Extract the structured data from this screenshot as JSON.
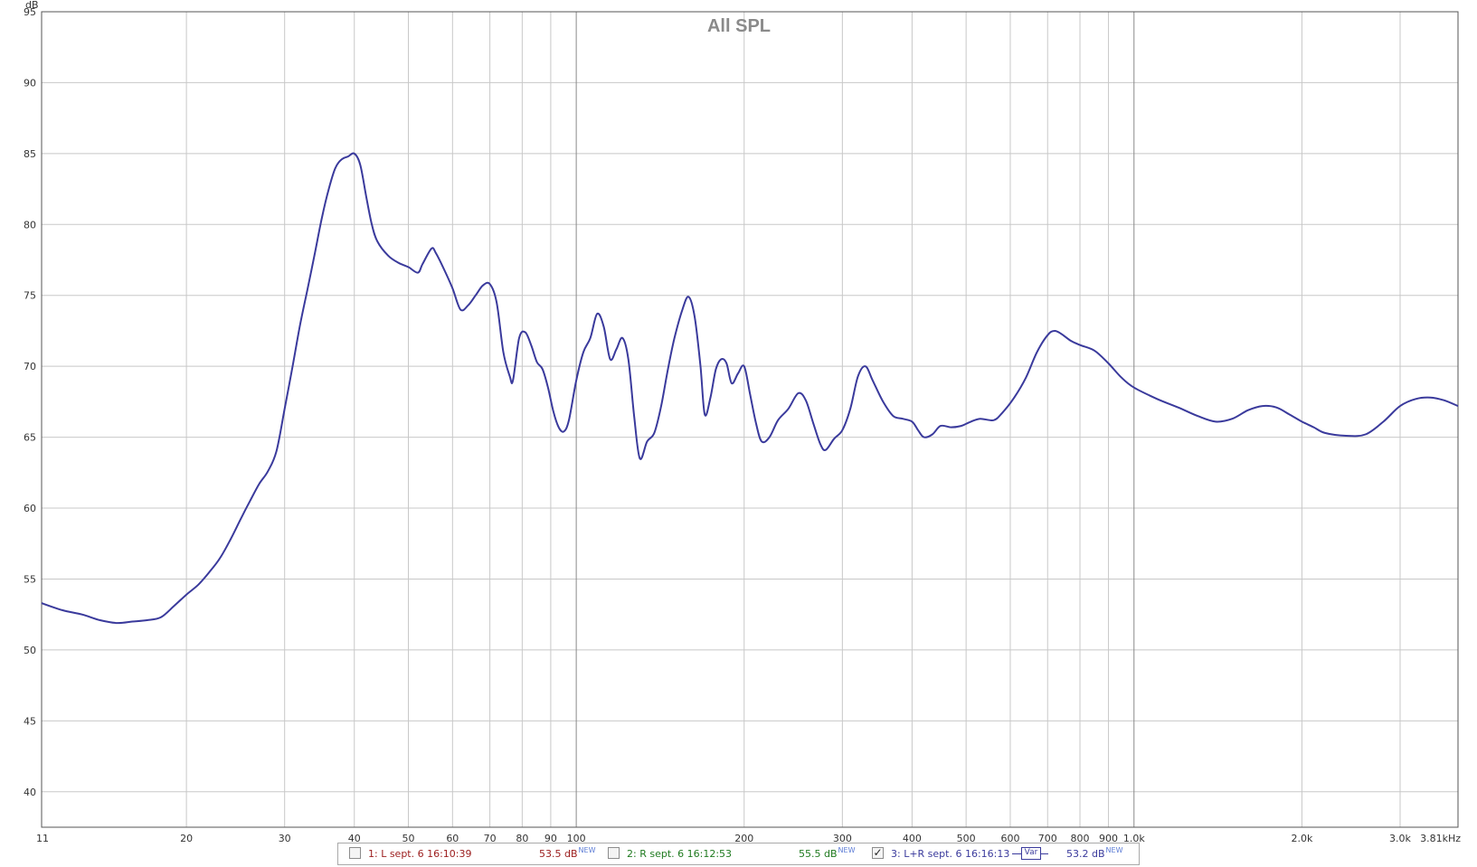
{
  "chart_data": {
    "type": "line",
    "title": "All SPL",
    "ylabel": "dB",
    "xscale": "log",
    "xlim": [
      11,
      3810
    ],
    "ylim": [
      37.5,
      95
    ],
    "grid": true,
    "legend_position": "bottom-center",
    "x_ticks": [
      {
        "value": 11,
        "label": "11"
      },
      {
        "value": 20,
        "label": "20"
      },
      {
        "value": 30,
        "label": "30"
      },
      {
        "value": 40,
        "label": "40"
      },
      {
        "value": 50,
        "label": "50"
      },
      {
        "value": 60,
        "label": "60"
      },
      {
        "value": 70,
        "label": "70"
      },
      {
        "value": 80,
        "label": "80"
      },
      {
        "value": 90,
        "label": "90"
      },
      {
        "value": 100,
        "label": "100"
      },
      {
        "value": 200,
        "label": "200"
      },
      {
        "value": 300,
        "label": "300"
      },
      {
        "value": 400,
        "label": "400"
      },
      {
        "value": 500,
        "label": "500"
      },
      {
        "value": 600,
        "label": "600"
      },
      {
        "value": 700,
        "label": "700"
      },
      {
        "value": 800,
        "label": "800"
      },
      {
        "value": 900,
        "label": "900"
      },
      {
        "value": 1000,
        "label": "1.0k"
      },
      {
        "value": 2000,
        "label": "2.0k"
      },
      {
        "value": 3000,
        "label": "3.0k"
      },
      {
        "value": 3810,
        "label": "3.81kHz"
      }
    ],
    "y_ticks": [
      95,
      90,
      85,
      80,
      75,
      70,
      65,
      60,
      55,
      50,
      45,
      40
    ],
    "series": [
      {
        "name": "3: L+R sept. 6 16:16:13",
        "color": "#3a3a9c",
        "points": [
          [
            11,
            53.3
          ],
          [
            12,
            52.8
          ],
          [
            13,
            52.5
          ],
          [
            14,
            52.1
          ],
          [
            15,
            51.9
          ],
          [
            16,
            52.0
          ],
          [
            17,
            52.1
          ],
          [
            18,
            52.3
          ],
          [
            19,
            53.1
          ],
          [
            20,
            53.9
          ],
          [
            21,
            54.6
          ],
          [
            22,
            55.5
          ],
          [
            23,
            56.5
          ],
          [
            24,
            57.8
          ],
          [
            25,
            59.2
          ],
          [
            26,
            60.5
          ],
          [
            27,
            61.7
          ],
          [
            28,
            62.6
          ],
          [
            29,
            64.0
          ],
          [
            30,
            67.0
          ],
          [
            31,
            70.0
          ],
          [
            32,
            73.0
          ],
          [
            33,
            75.5
          ],
          [
            34,
            78.0
          ],
          [
            35,
            80.5
          ],
          [
            36,
            82.5
          ],
          [
            37,
            84.0
          ],
          [
            38,
            84.6
          ],
          [
            39,
            84.8
          ],
          [
            40,
            85.0
          ],
          [
            41,
            84.2
          ],
          [
            42,
            82.0
          ],
          [
            43,
            80.0
          ],
          [
            44,
            78.8
          ],
          [
            46,
            77.8
          ],
          [
            48,
            77.3
          ],
          [
            50,
            77.0
          ],
          [
            52,
            76.6
          ],
          [
            53,
            77.2
          ],
          [
            55,
            78.3
          ],
          [
            56,
            78.0
          ],
          [
            58,
            76.8
          ],
          [
            60,
            75.5
          ],
          [
            62,
            74.0
          ],
          [
            64,
            74.3
          ],
          [
            66,
            75.0
          ],
          [
            68,
            75.7
          ],
          [
            70,
            75.8
          ],
          [
            72,
            74.5
          ],
          [
            74,
            71.0
          ],
          [
            76,
            69.3
          ],
          [
            77,
            69.0
          ],
          [
            79,
            72.0
          ],
          [
            81,
            72.4
          ],
          [
            83,
            71.5
          ],
          [
            85,
            70.3
          ],
          [
            87,
            69.8
          ],
          [
            89,
            68.5
          ],
          [
            91,
            66.8
          ],
          [
            93,
            65.7
          ],
          [
            95,
            65.4
          ],
          [
            97,
            66.2
          ],
          [
            100,
            69.0
          ],
          [
            103,
            71.0
          ],
          [
            106,
            72.0
          ],
          [
            109,
            73.7
          ],
          [
            112,
            72.8
          ],
          [
            115,
            70.5
          ],
          [
            118,
            71.2
          ],
          [
            121,
            72.0
          ],
          [
            124,
            70.5
          ],
          [
            127,
            66.5
          ],
          [
            130,
            63.5
          ],
          [
            134,
            64.7
          ],
          [
            138,
            65.3
          ],
          [
            142,
            67.2
          ],
          [
            146,
            69.8
          ],
          [
            150,
            72.0
          ],
          [
            155,
            74.0
          ],
          [
            159,
            74.9
          ],
          [
            163,
            73.5
          ],
          [
            167,
            70.0
          ],
          [
            170,
            66.6
          ],
          [
            174,
            67.8
          ],
          [
            178,
            69.8
          ],
          [
            182,
            70.5
          ],
          [
            186,
            70.2
          ],
          [
            190,
            68.8
          ],
          [
            195,
            69.5
          ],
          [
            200,
            70.0
          ],
          [
            205,
            68.0
          ],
          [
            210,
            66.0
          ],
          [
            215,
            64.7
          ],
          [
            222,
            65.0
          ],
          [
            230,
            66.2
          ],
          [
            240,
            67.0
          ],
          [
            250,
            68.1
          ],
          [
            258,
            67.6
          ],
          [
            266,
            66.0
          ],
          [
            274,
            64.5
          ],
          [
            280,
            64.1
          ],
          [
            290,
            64.9
          ],
          [
            300,
            65.5
          ],
          [
            310,
            67.0
          ],
          [
            320,
            69.3
          ],
          [
            330,
            70.0
          ],
          [
            340,
            69.0
          ],
          [
            355,
            67.5
          ],
          [
            370,
            66.5
          ],
          [
            385,
            66.3
          ],
          [
            400,
            66.1
          ],
          [
            410,
            65.5
          ],
          [
            420,
            65.0
          ],
          [
            435,
            65.2
          ],
          [
            450,
            65.8
          ],
          [
            470,
            65.7
          ],
          [
            490,
            65.8
          ],
          [
            510,
            66.1
          ],
          [
            530,
            66.3
          ],
          [
            560,
            66.2
          ],
          [
            580,
            66.7
          ],
          [
            610,
            67.8
          ],
          [
            640,
            69.2
          ],
          [
            670,
            71.0
          ],
          [
            700,
            72.2
          ],
          [
            720,
            72.5
          ],
          [
            740,
            72.3
          ],
          [
            770,
            71.8
          ],
          [
            800,
            71.5
          ],
          [
            850,
            71.1
          ],
          [
            900,
            70.2
          ],
          [
            950,
            69.2
          ],
          [
            1000,
            68.5
          ],
          [
            1100,
            67.7
          ],
          [
            1200,
            67.1
          ],
          [
            1300,
            66.5
          ],
          [
            1400,
            66.1
          ],
          [
            1500,
            66.3
          ],
          [
            1600,
            66.9
          ],
          [
            1700,
            67.2
          ],
          [
            1800,
            67.1
          ],
          [
            1900,
            66.6
          ],
          [
            2000,
            66.1
          ],
          [
            2100,
            65.7
          ],
          [
            2200,
            65.3
          ],
          [
            2400,
            65.1
          ],
          [
            2600,
            65.2
          ],
          [
            2800,
            66.1
          ],
          [
            3000,
            67.2
          ],
          [
            3200,
            67.7
          ],
          [
            3400,
            67.8
          ],
          [
            3600,
            67.6
          ],
          [
            3810,
            67.2
          ]
        ]
      }
    ],
    "legend": [
      {
        "index_label": "1: L sept. 6 16:10:39",
        "level": "53.5 dB",
        "tag": "NEW",
        "checked": false,
        "color": "#9b1c1c"
      },
      {
        "index_label": "2: R sept. 6 16:12:53",
        "level": "55.5 dB",
        "tag": "NEW",
        "checked": false,
        "color": "#1f7a1f"
      },
      {
        "index_label": "3: L+R sept. 6 16:16:13",
        "level": "53.2 dB",
        "tag": "NEW",
        "checked": true,
        "color": "#3a3a9c",
        "smoothing_label": "Var"
      }
    ]
  },
  "ui": {
    "check_glyph": "✓"
  }
}
